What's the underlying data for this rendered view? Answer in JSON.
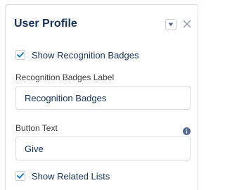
{
  "panel": {
    "title": "User Profile"
  },
  "fields": {
    "show_recognition_badges": {
      "label": "Show Recognition Badges",
      "checked": true
    },
    "recognition_badges_label": {
      "label": "Recognition Badges Label",
      "value": "Recognition Badges"
    },
    "button_text": {
      "label": "Button Text",
      "value": "Give"
    },
    "show_related_lists": {
      "label": "Show Related Lists",
      "checked": true
    }
  },
  "icons": {
    "dropdown": "chevron-down-icon",
    "close": "close-icon",
    "info": "info-icon",
    "check": "checkmark-icon"
  },
  "colors": {
    "accent": "#0070d2",
    "text": "#16325c",
    "border": "#d8dde6"
  }
}
